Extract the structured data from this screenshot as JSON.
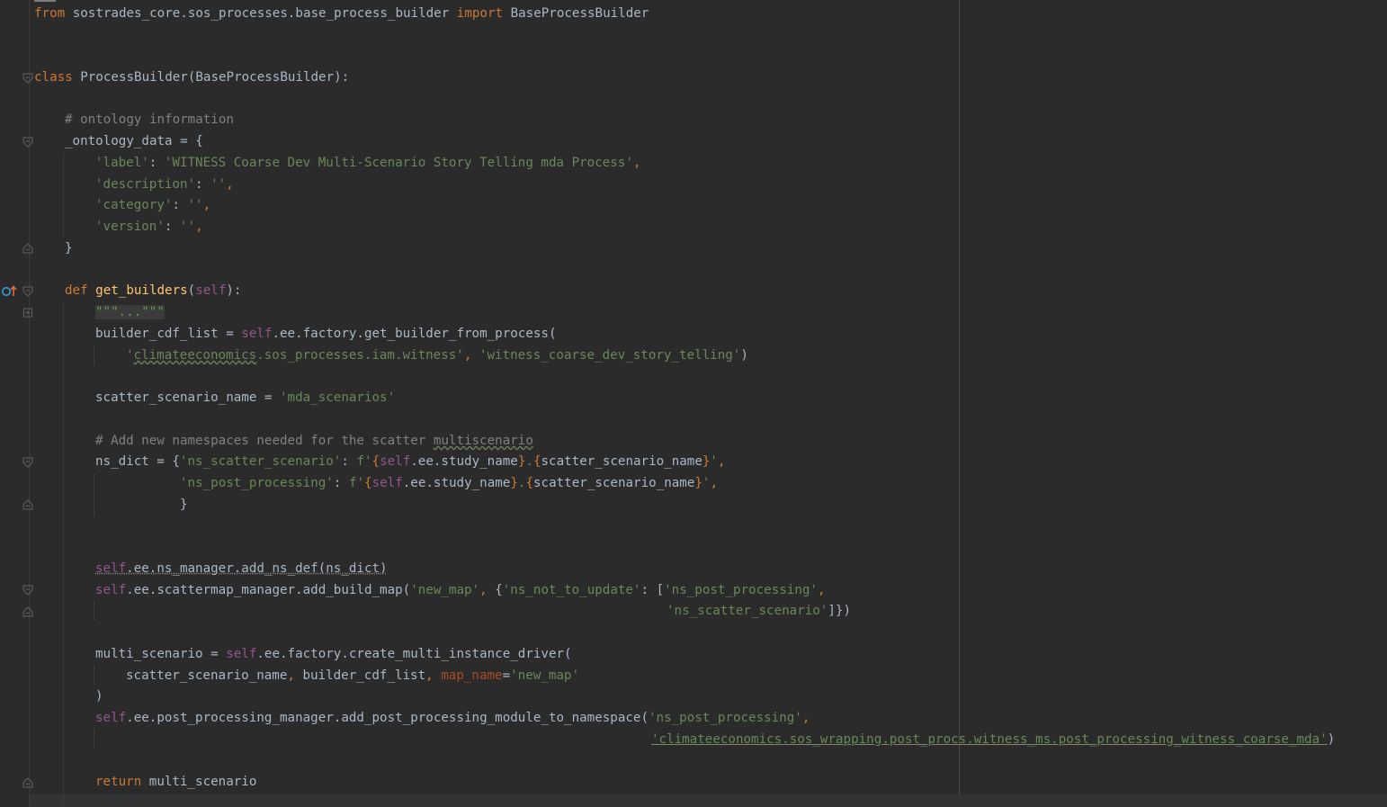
{
  "editor": {
    "language": "python",
    "colors": {
      "background": "#2b2b2b",
      "keyword": "#cc7832",
      "string": "#6a8759",
      "comment": "#808080",
      "function": "#ffc66d",
      "self": "#94558d",
      "param": "#aa4926",
      "text": "#a9b7c6"
    },
    "gutter_icons": [
      "override-method-icon",
      "fold-marker-icon"
    ],
    "lines": {
      "l1": {
        "kw_from": "from",
        "mod": " sostrades_core.sos_processes.base_process_builder ",
        "kw_import": "import",
        "name": " BaseProcessBuilder"
      },
      "l2": {
        "kw": "class",
        "rest": " ProcessBuilder(BaseProcessBuilder):"
      },
      "l3": {
        "comment": "# ontology information"
      },
      "l4": {
        "text": "_ontology_data = {"
      },
      "l5": {
        "key": "'label'",
        "colon": ": ",
        "val": "'WITNESS Coarse Dev Multi-Scenario Story Telling mda Process'",
        "comma": ","
      },
      "l6": {
        "key": "'description'",
        "colon": ": ",
        "val": "''",
        "comma": ","
      },
      "l7": {
        "key": "'category'",
        "colon": ": ",
        "val": "''",
        "comma": ","
      },
      "l8": {
        "key": "'version'",
        "colon": ": ",
        "val": "''",
        "comma": ","
      },
      "l9": {
        "text": "}"
      },
      "l10": {
        "kw": "def",
        "sp": " ",
        "fn": "get_builders",
        "open": "(",
        "self": "self",
        "close": "):"
      },
      "l11": {
        "docstring": "\"\"\"...\"\"\""
      },
      "l12": {
        "a": "builder_cdf_list = ",
        "self": "self",
        "b": ".ee.factory.get_builder_from_process("
      },
      "l13": {
        "q1": "'",
        "u": "climateeconomics",
        "s1": ".sos_processes.iam.witness'",
        "sep": ", ",
        "s2": "'witness_coarse_dev_story_telling'",
        "close": ")"
      },
      "l14": {
        "a": "scatter_scenario_name = ",
        "s": "'mda_scenarios'"
      },
      "l15": {
        "c": "# Add new namespaces needed for the scatter ",
        "u": "multiscenario"
      },
      "l16": {
        "a": "ns_dict = {",
        "k": "'ns_scatter_scenario'",
        "colon": ": ",
        "f": "f'",
        "b1": "{",
        "self": "self",
        "b2": ".ee.study_name",
        "b3": "}",
        "dot": ".",
        "b4": "{",
        "b5": "scatter_scenario_name",
        "b6": "}",
        "q": "'",
        "comma": ","
      },
      "l17": {
        "k": "'ns_post_processing'",
        "colon": ": ",
        "f": "f'",
        "b1": "{",
        "self": "self",
        "b2": ".ee.study_name",
        "b3": "}",
        "dot": ".",
        "b4": "{",
        "b5": "scatter_scenario_name",
        "b6": "}",
        "q": "'",
        "comma": ","
      },
      "l18": {
        "text": "}"
      },
      "l19": {
        "self": "self",
        "rest": ".ee.ns_manager.add_ns_def(ns_dict)"
      },
      "l20": {
        "self": "self",
        "a": ".ee.scattermap_manager.add_build_map(",
        "s1": "'new_map'",
        "sep": ", ",
        "b": "{",
        "s2": "'ns_not_to_update'",
        "colon": ": [",
        "s3": "'ns_post_processing'",
        "comma": ","
      },
      "l21": {
        "s": "'ns_scatter_scenario'",
        "close": "]})"
      },
      "l22": {
        "a": "multi_scenario = ",
        "self": "self",
        "b": ".ee.factory.create_multi_instance_driver("
      },
      "l23": {
        "a": "scatter_scenario_name",
        "sep1": ", ",
        "b": "builder_cdf_list",
        "sep2": ", ",
        "p": "map_name",
        "eq": "=",
        "s": "'new_map'"
      },
      "l24": {
        "text": ")"
      },
      "l25": {
        "self": "self",
        "a": ".ee.post_processing_manager.add_post_processing_module_to_namespace(",
        "s": "'ns_post_processing'",
        "comma": ","
      },
      "l26": {
        "s": "'climateeconomics.sos_wrapping.post_procs.witness_ms.post_processing_witness_coarse_mda'",
        "close": ")"
      },
      "l27": {
        "kw": "return",
        "rest": " multi_scenario"
      }
    }
  }
}
